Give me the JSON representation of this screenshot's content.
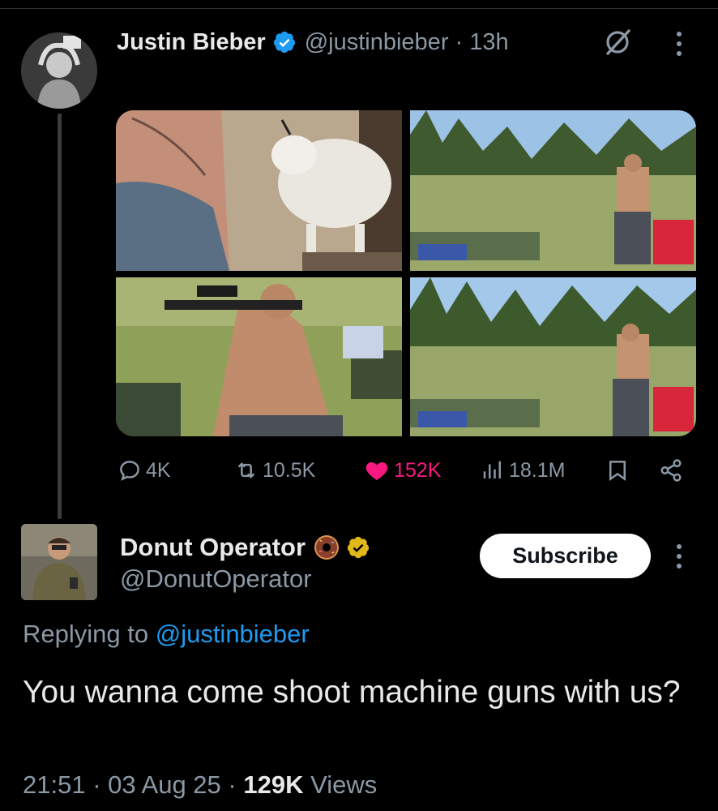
{
  "tweet": {
    "author_name": "Justin Bieber",
    "handle": "@justinbieber",
    "time": "13h",
    "separator": "·",
    "actions": {
      "replies": "4K",
      "retweets": "10.5K",
      "likes": "152K",
      "views": "18.1M"
    },
    "icons": [
      "verified-badge-icon",
      "grok-icon",
      "more-icon",
      "reply-icon",
      "retweet-icon",
      "like-icon",
      "views-icon",
      "bookmark-icon",
      "share-icon"
    ]
  },
  "reply": {
    "author_name": "Donut Operator",
    "handle": "@DonutOperator",
    "subscribe_label": "Subscribe",
    "replying_prefix": "Replying to",
    "replying_to": "@justinbieber",
    "text": "You wanna come shoot machine guns with us?",
    "time": "21:51",
    "date": "03 Aug 25",
    "separator": "·",
    "views_count": "129K",
    "views_label": "Views"
  },
  "colors": {
    "background": "#000000",
    "text_primary": "#e7e9ea",
    "text_secondary": "#8b98a5",
    "link": "#1d9bf0",
    "like": "#f91880",
    "verified_blue": "#1d9bf0",
    "verified_gold": "#e2b719"
  }
}
